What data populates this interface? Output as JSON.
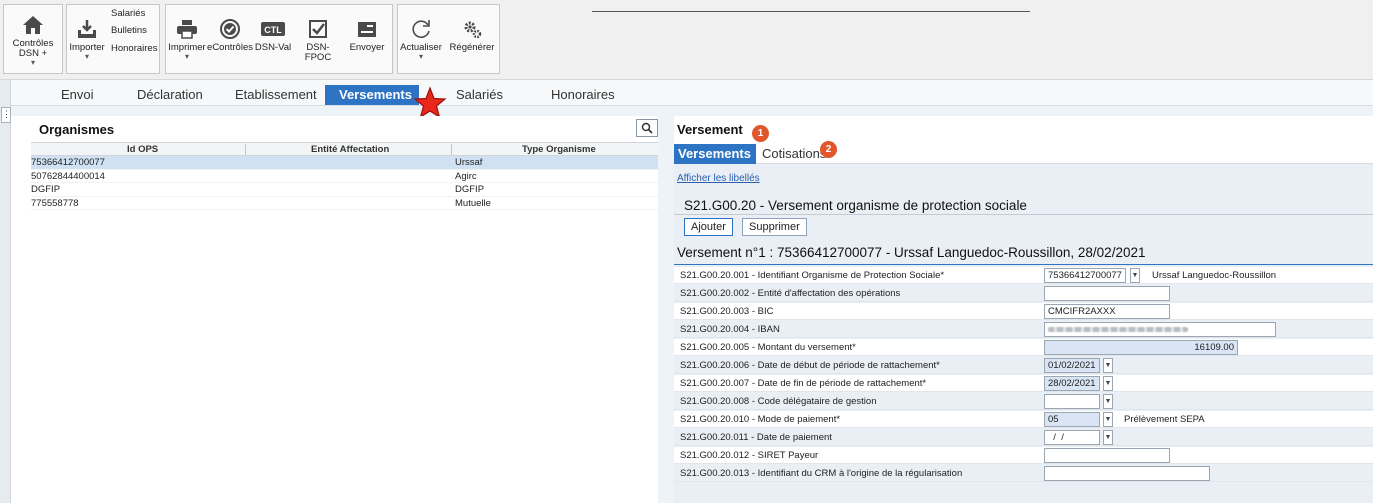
{
  "toolbar": {
    "controles_label": "Contrôles DSN +",
    "importer_label": "Importer",
    "salaries_label": "Salariés",
    "bulletins_label": "Bulletins",
    "honoraires_label": "Honoraires",
    "imprimer_label": "Imprimer",
    "econtroles_label": "eContrôles",
    "dsnval_label": "DSN-Val",
    "dsnfpoc_label": "DSN-FPOC",
    "envoyer_label": "Envoyer",
    "actualiser_label": "Actualiser",
    "regenerer_label": "Régénérer",
    "ctl_text": "CTL"
  },
  "tabs": [
    "Envoi",
    "Déclaration",
    "Etablissement",
    "Versements",
    "Salariés",
    "Honoraires"
  ],
  "active_tab": "Versements",
  "left": {
    "title": "Organismes",
    "columns": [
      "Id OPS",
      "Entité Affectation",
      "Type Organisme"
    ],
    "rows": [
      {
        "id": "75366412700077",
        "entite": "",
        "type": "Urssaf"
      },
      {
        "id": "50762844400014",
        "entite": "",
        "type": "Agirc"
      },
      {
        "id": "DGFIP",
        "entite": "",
        "type": "DGFIP"
      },
      {
        "id": "775558778",
        "entite": "",
        "type": "Mutuelle"
      }
    ]
  },
  "right": {
    "title": "Versement",
    "badge1": "1",
    "badge2": "2",
    "subtabs": [
      "Versements",
      "Cotisations"
    ],
    "link": "Afficher les libellés",
    "section_title": "S21.G00.20 - Versement organisme de protection sociale",
    "btn_add": "Ajouter",
    "btn_delete": "Supprimer",
    "versement_title": "Versement n°1 : 75366412700077 - Urssaf Languedoc-Roussillon, 28/02/2021",
    "fields": [
      {
        "label": "S21.G00.20.001 - Identifiant Organisme de Protection Sociale*",
        "value": "75366412700077",
        "desc": "Urssaf Languedoc-Roussillon"
      },
      {
        "label": "S21.G00.20.002 - Entité d'affectation des opérations",
        "value": ""
      },
      {
        "label": "S21.G00.20.003 - BIC",
        "value": "CMCIFR2AXXX"
      },
      {
        "label": "S21.G00.20.004 - IBAN",
        "value": ""
      },
      {
        "label": "S21.G00.20.005 - Montant du versement*",
        "value": "16109.00"
      },
      {
        "label": "S21.G00.20.006 - Date de début de période de rattachement*",
        "value": "01/02/2021"
      },
      {
        "label": "S21.G00.20.007 - Date de fin de période de rattachement*",
        "value": "28/02/2021"
      },
      {
        "label": "S21.G00.20.008 - Code délégataire de gestion",
        "value": ""
      },
      {
        "label": "S21.G00.20.010 - Mode de paiement*",
        "value": "05",
        "desc": "Prélèvement SEPA"
      },
      {
        "label": "S21.G00.20.011 - Date de paiement",
        "value": "  /  /"
      },
      {
        "label": "S21.G00.20.012 - SIRET Payeur",
        "value": ""
      },
      {
        "label": "S21.G00.20.013 - Identifiant du CRM à l'origine de la régularisation",
        "value": ""
      }
    ]
  },
  "colors": {
    "accent": "#2e74c4",
    "badge": "#e2562b",
    "selected_row": "#cfe1f3",
    "star": "#e8281c"
  }
}
